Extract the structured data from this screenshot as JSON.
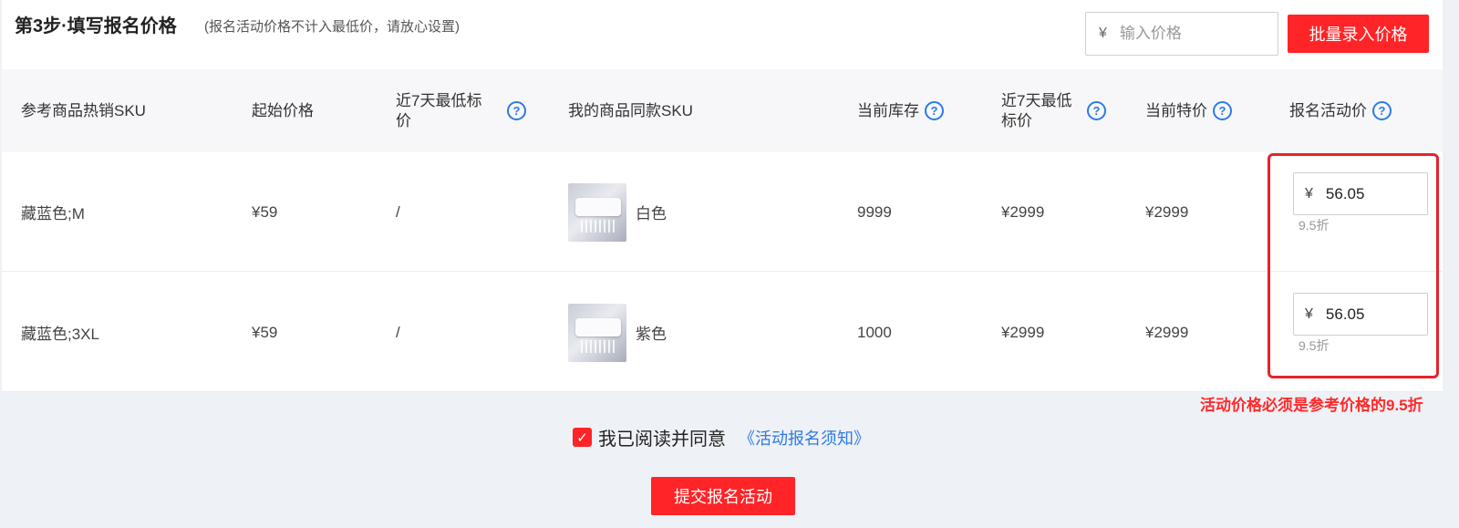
{
  "header": {
    "title": "第3步·填写报名价格",
    "note": "(报名活动价格不计入最低价，请放心设置)",
    "price_input": {
      "currency": "¥",
      "placeholder": "输入价格",
      "value": ""
    },
    "batch_button": "批量录入价格"
  },
  "table": {
    "columns": [
      {
        "label": "参考商品热销SKU",
        "help": false
      },
      {
        "label": "起始价格",
        "help": false
      },
      {
        "label": "近7天最低标价",
        "help": true
      },
      {
        "label": "我的商品同款SKU",
        "help": false
      },
      {
        "label": "当前库存",
        "help": true
      },
      {
        "label": "近7天最低标价",
        "help": true
      },
      {
        "label": "当前特价",
        "help": true
      },
      {
        "label": "报名活动价",
        "help": true
      }
    ],
    "help_glyph": "?",
    "rows": [
      {
        "ref_sku": "藏蓝色;M",
        "start_price": "¥59",
        "lowest_7d": "/",
        "my_sku_image": "air-conditioner-image",
        "my_sku": "白色",
        "stock": "9999",
        "lowest_7d_price": "¥2999",
        "current_special": "¥2999",
        "activity_currency": "¥",
        "activity_price": "56.05",
        "discount": "9.5折"
      },
      {
        "ref_sku": "藏蓝色;3XL",
        "start_price": "¥59",
        "lowest_7d": "/",
        "my_sku_image": "air-conditioner-image",
        "my_sku": "紫色",
        "stock": "1000",
        "lowest_7d_price": "¥2999",
        "current_special": "¥2999",
        "activity_currency": "¥",
        "activity_price": "56.05",
        "discount": "9.5折"
      }
    ]
  },
  "warning": "活动价格必须是参考价格的9.5折",
  "agreement": {
    "checked": true,
    "check_glyph": "✓",
    "text": "我已阅读并同意",
    "link": "《活动报名须知》"
  },
  "submit_button": "提交报名活动",
  "colors": {
    "primary_red": "#ff2427",
    "link_blue": "#2d7be5",
    "highlight_red": "#e8212c"
  }
}
